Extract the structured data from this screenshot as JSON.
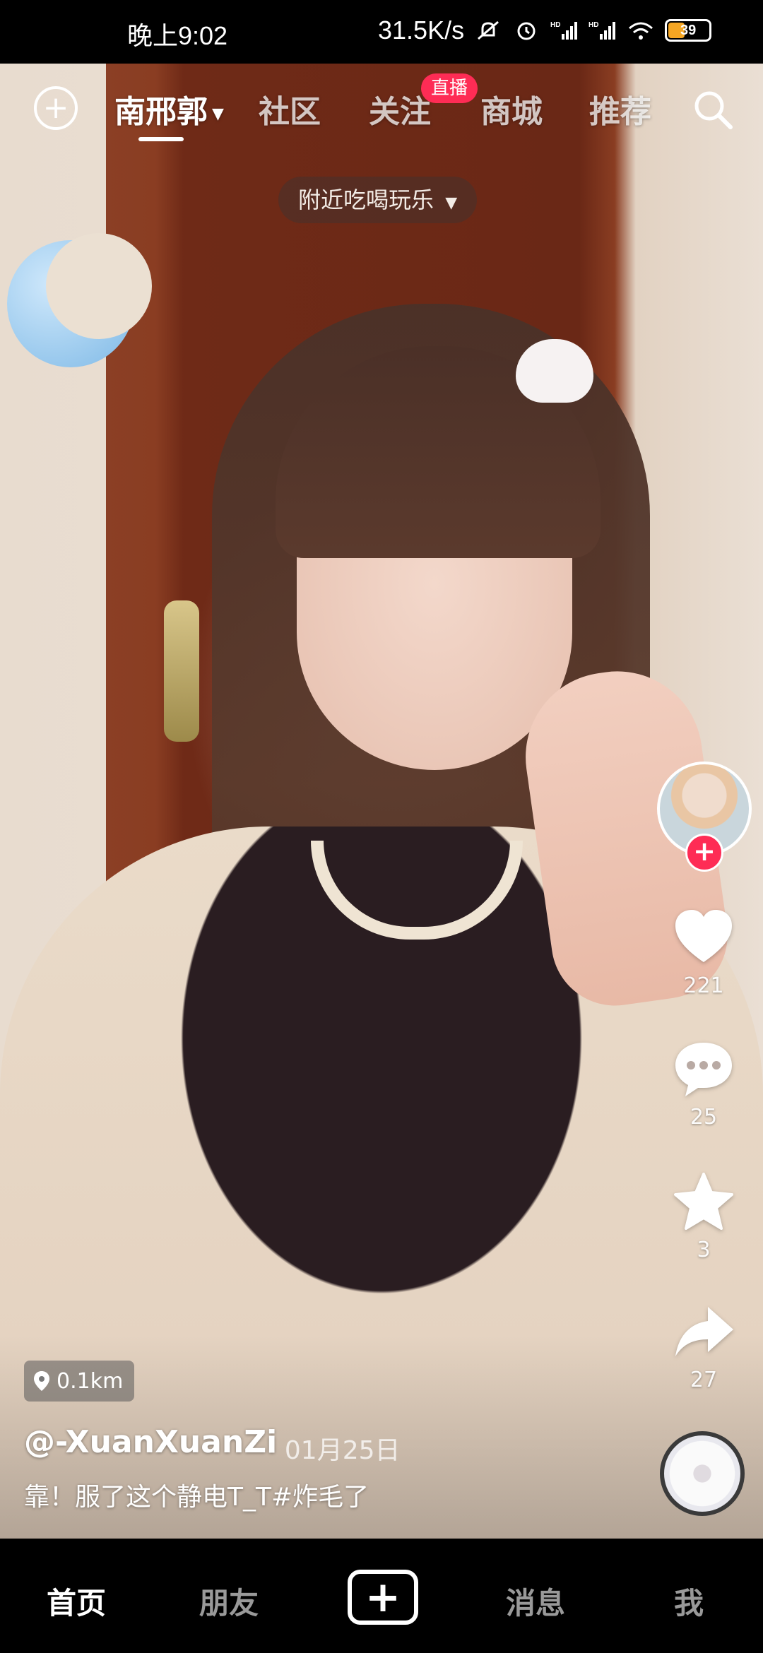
{
  "status_bar": {
    "time": "晚上9:02",
    "network_speed": "31.5K/s",
    "battery_level": "39",
    "icons": [
      "mute-icon",
      "alarm-icon",
      "hd-signal-icon",
      "hd-signal-icon",
      "wifi-icon",
      "battery-icon"
    ]
  },
  "top_nav": {
    "add_icon": "plus-circle-icon",
    "tabs": [
      {
        "label": "南邢郭",
        "active": true,
        "has_dropdown": true
      },
      {
        "label": "社区",
        "active": false
      },
      {
        "label": "关注",
        "active": false
      },
      {
        "label": "商城",
        "active": false
      },
      {
        "label": "推荐",
        "active": false
      }
    ],
    "live_badge": "直播",
    "search_icon": "search-icon"
  },
  "nearby_filter": {
    "label": "附近吃喝玩乐",
    "icon": "caret-down-icon"
  },
  "actions": {
    "likes": "221",
    "comments": "25",
    "favorites": "3",
    "shares": "27",
    "follow_icon": "plus-icon"
  },
  "post": {
    "distance": "0.1km",
    "author": "@-XuanXuanZi",
    "date": "· 01月25日",
    "caption": "靠！服了这个静电T_T#炸毛了"
  },
  "bottom_tabs": {
    "home": "首页",
    "friends": "朋友",
    "create_icon": "plus-square-icon",
    "messages": "消息",
    "me": "我"
  },
  "colors": {
    "accent": "#fe2c55",
    "battery": "#f5a623",
    "bar_bg": "#000000"
  }
}
